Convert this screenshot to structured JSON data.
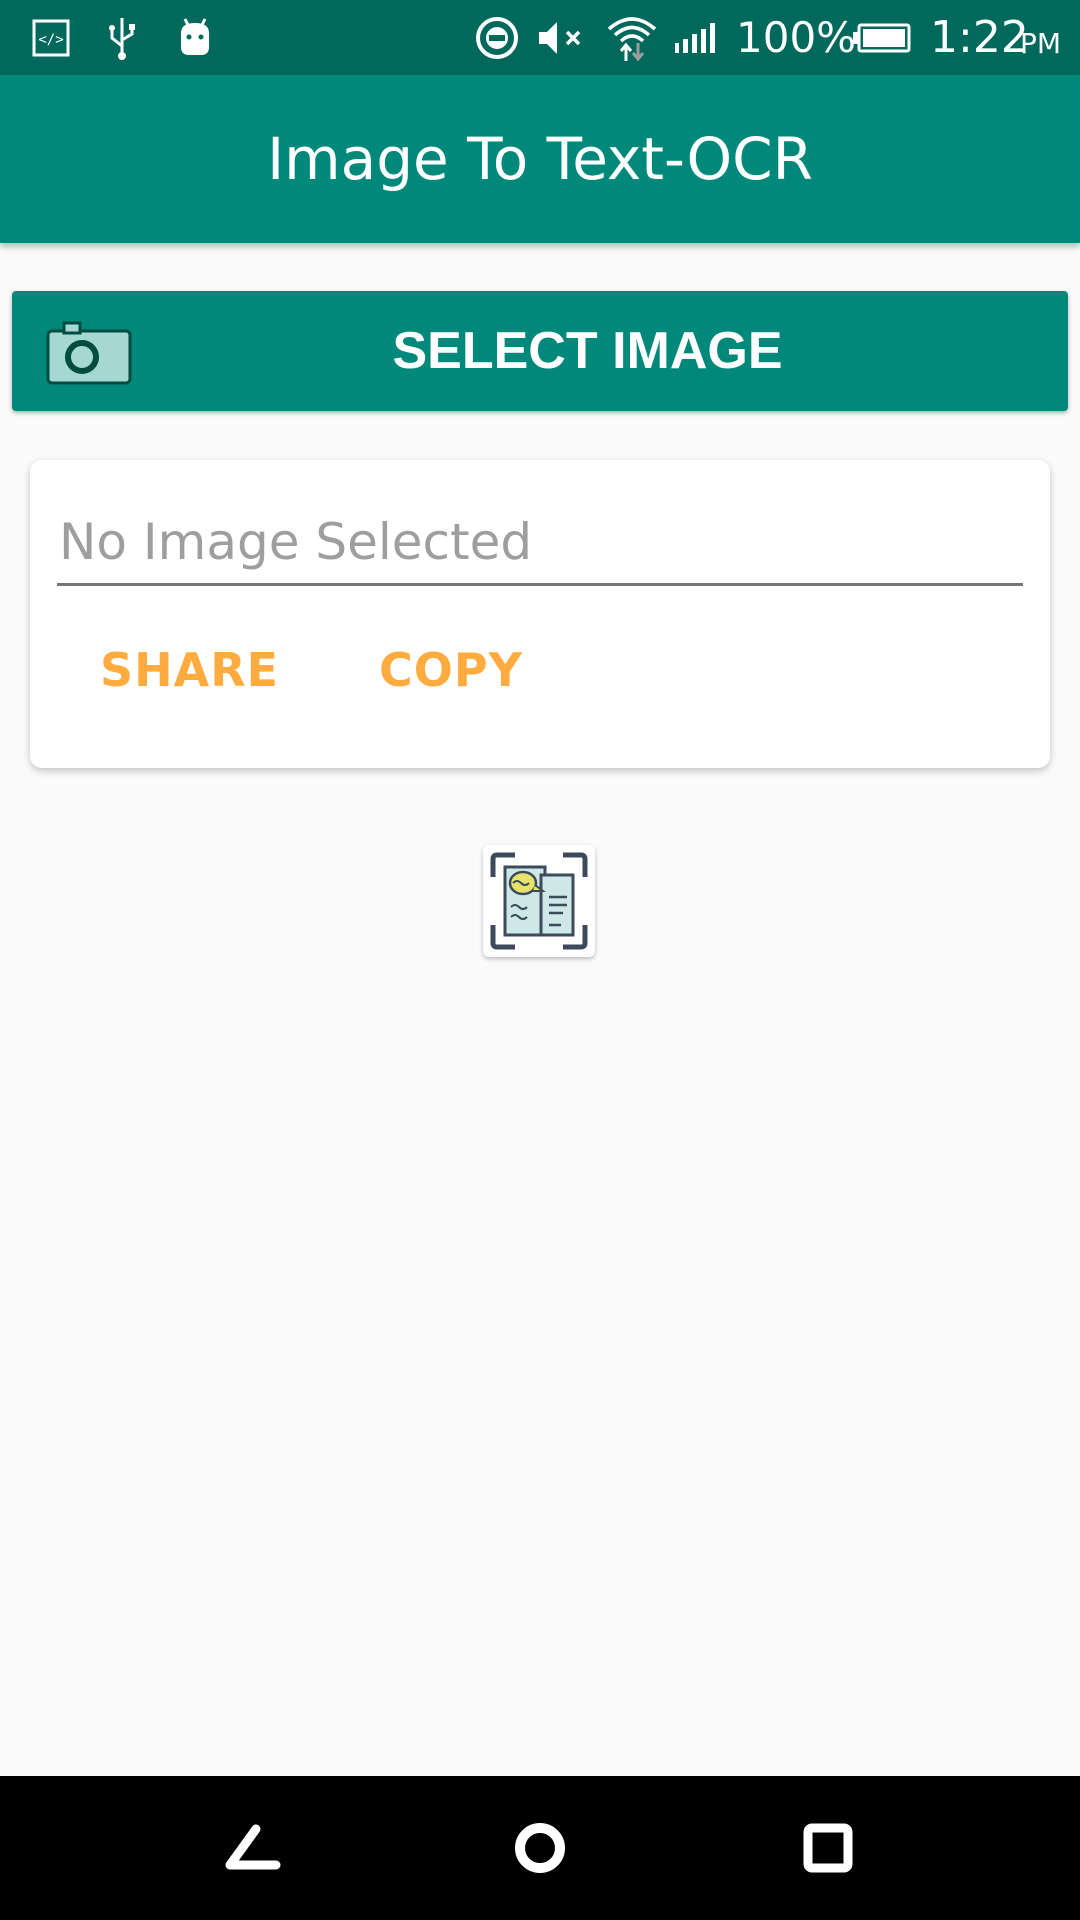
{
  "status_bar": {
    "battery_percent": "100%",
    "time": "1:22",
    "ampm": "PM",
    "icons": [
      "code-icon",
      "usb-icon",
      "android-icon",
      "do-not-disturb-icon",
      "mute-icon",
      "wifi-icon",
      "signal-icon",
      "battery-icon"
    ]
  },
  "app_bar": {
    "title": "Image To Text-OCR"
  },
  "select_button": {
    "label": "SELECT IMAGE",
    "icon": "camera-icon"
  },
  "result_card": {
    "placeholder": "No Image Selected",
    "value": "",
    "share_label": "SHARE",
    "copy_label": "COPY"
  },
  "logo": {
    "icon": "scan-document-icon"
  },
  "nav_bar": {
    "icons": [
      "back-icon",
      "home-icon",
      "recents-icon"
    ]
  },
  "colors": {
    "primary": "#00897b",
    "primary_dark": "#00695c",
    "accent": "#ffab40",
    "background": "#fafafa"
  }
}
